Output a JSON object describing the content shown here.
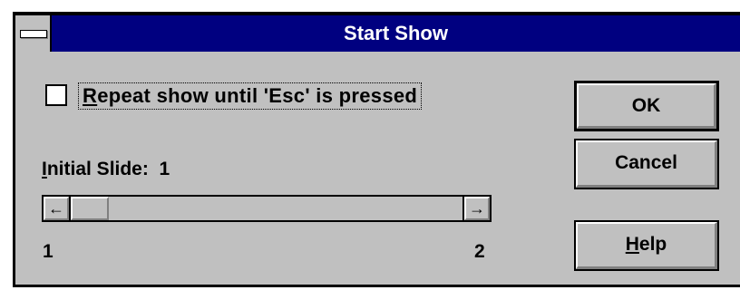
{
  "dialog": {
    "title": "Start Show",
    "repeat_checkbox": {
      "checked": false,
      "label_accel": "R",
      "label_rest": "epeat show until 'Esc' is pressed"
    },
    "initial_slide": {
      "label_accel": "I",
      "label_rest": "nitial Slide:",
      "value": "1"
    },
    "scrollbar": {
      "left_arrow": "←",
      "right_arrow": "→",
      "min_label": "1",
      "max_label": "2",
      "position": 0
    },
    "buttons": {
      "ok": "OK",
      "cancel": "Cancel",
      "help_accel": "H",
      "help_rest": "elp"
    }
  }
}
